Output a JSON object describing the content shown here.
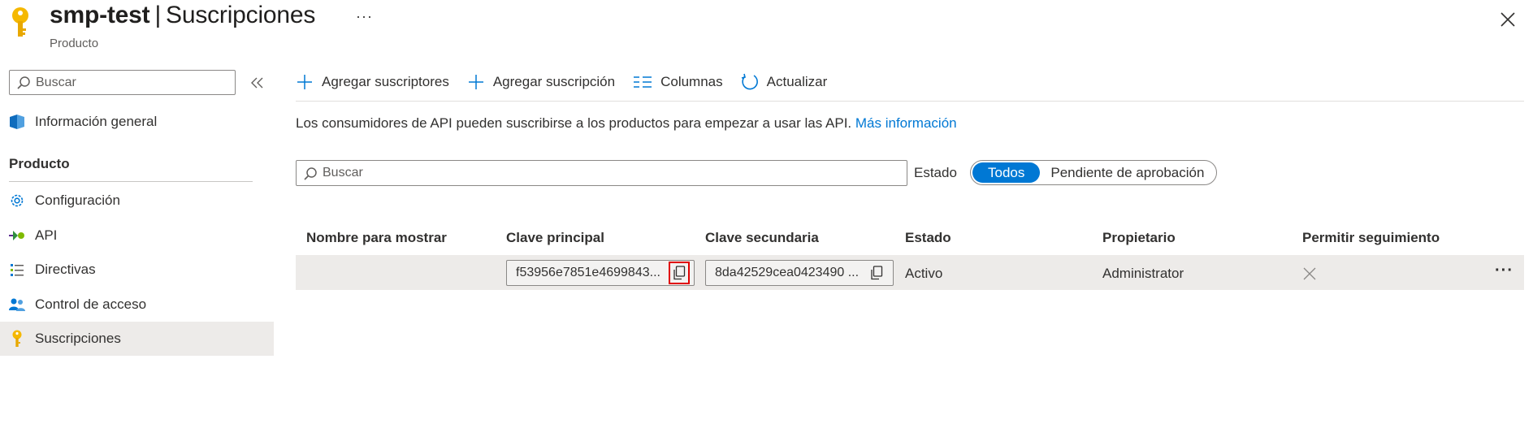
{
  "header": {
    "resource_name": "smp-test",
    "separator": "|",
    "page_name": "Suscripciones",
    "subtitle": "Producto",
    "more_label": "···"
  },
  "sidebar": {
    "search_placeholder": "Buscar",
    "overview": "Información general",
    "section_title": "Producto",
    "items": [
      {
        "label": "Configuración",
        "icon": "gear-icon"
      },
      {
        "label": "API",
        "icon": "api-icon"
      },
      {
        "label": "Directivas",
        "icon": "policies-icon"
      },
      {
        "label": "Control de acceso",
        "icon": "access-control-icon"
      },
      {
        "label": "Suscripciones",
        "icon": "key-icon",
        "selected": true
      }
    ]
  },
  "toolbar": {
    "add_subscribers": "Agregar suscriptores",
    "add_subscription": "Agregar suscripción",
    "columns": "Columnas",
    "refresh": "Actualizar"
  },
  "info": {
    "text": "Los consumidores de API pueden suscribirse a los productos para empezar a usar las API.",
    "link": "Más información"
  },
  "filters": {
    "search_placeholder": "Buscar",
    "state_label": "Estado",
    "options": [
      "Todos",
      "Pendiente de aprobación"
    ],
    "selected": "Todos"
  },
  "table": {
    "headers": [
      "Nombre para mostrar",
      "Clave principal",
      "Clave secundaria",
      "Estado",
      "Propietario",
      "Permitir seguimiento"
    ],
    "rows": [
      {
        "display_name": "",
        "primary_key": "f53956e7851e4699843...",
        "secondary_key": "8da42529cea0423490 ...",
        "state": "Activo",
        "owner": "Administrator",
        "allow_tracing": false
      }
    ],
    "row_menu": "···"
  },
  "colors": {
    "accent": "#0078d4",
    "key_yellow": "#f5b800",
    "highlight_border": "#e00000",
    "row_background": "#edebe9"
  }
}
